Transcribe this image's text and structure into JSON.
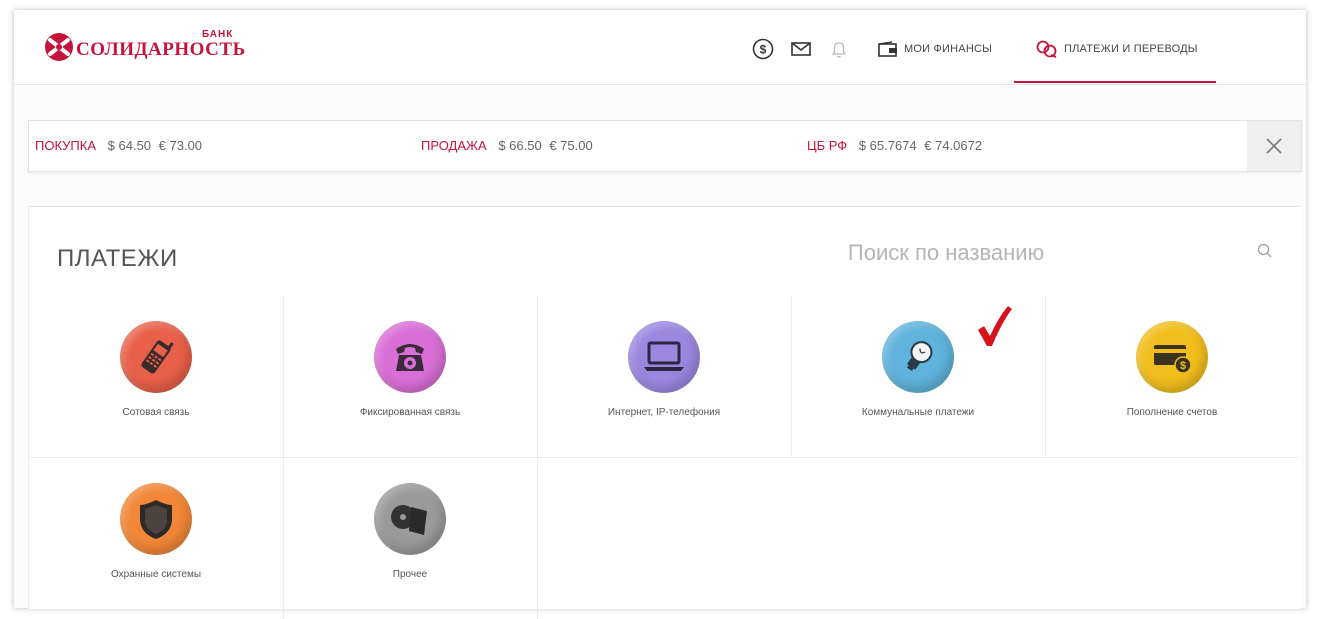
{
  "header": {
    "logo_text": "СОЛИДАРНОСТЬ",
    "logo_bank": "БАНК",
    "icons": [
      "dollar-icon",
      "mail-icon",
      "bell-icon"
    ],
    "nav": [
      {
        "label": "МОИ ФИНАНСЫ",
        "icon": "wallet-icon",
        "active": false
      },
      {
        "label": "ПЛАТЕЖИ И ПЕРЕВОДЫ",
        "icon": "transfer-icon",
        "active": true
      }
    ]
  },
  "rates": {
    "buy": {
      "label": "ПОКУПКА",
      "usd": "$ 64.50",
      "eur": "€ 73.00"
    },
    "sell": {
      "label": "ПРОДАЖА",
      "usd": "$ 66.50",
      "eur": "€ 75.00"
    },
    "cb": {
      "label": "ЦБ РФ",
      "usd": "$ 65.7674",
      "eur": "€ 74.0672"
    },
    "close_icon": "close-icon"
  },
  "payments": {
    "title": "ПЛАТЕЖИ",
    "search_placeholder": "Поиск по названию",
    "categories": [
      {
        "label": "Сотовая связь",
        "icon": "mobile-phone-icon",
        "color": "#e8604a"
      },
      {
        "label": "Фиксированная связь",
        "icon": "landline-phone-icon",
        "color": "#d96fd6"
      },
      {
        "label": "Интернет, IP-телефония",
        "icon": "laptop-icon",
        "color": "#9b87e0"
      },
      {
        "label": "Коммунальные платежи",
        "icon": "lightbulb-icon",
        "color": "#5fb3dc"
      },
      {
        "label": "Пополнение счетов",
        "icon": "card-coin-icon",
        "color": "#f2be1d"
      },
      {
        "label": "Охранные системы",
        "icon": "shield-icon",
        "color": "#f28737"
      },
      {
        "label": "Прочее",
        "icon": "disc-icon",
        "color": "#9a9a9a"
      }
    ]
  },
  "colors": {
    "accent": "#c4143c",
    "checkmark": "#d8121c"
  }
}
